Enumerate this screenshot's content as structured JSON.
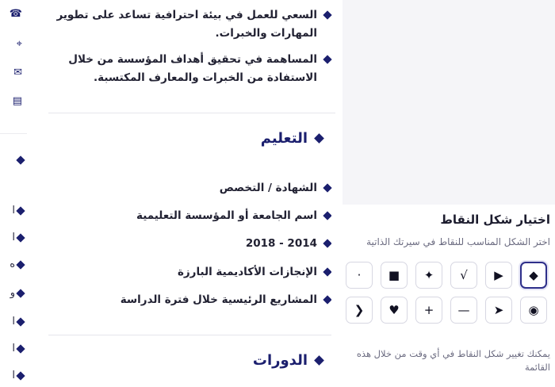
{
  "experience": {
    "bullets": [
      "السعي للعمل في بيئة احترافية تساعد على تطوير المهارات والخبرات.",
      "المساهمة في تحقيق أهداف المؤسسة من خلال الاستفادة من الخبرات والمعارف المكتسبة."
    ]
  },
  "education": {
    "title": "التعليم",
    "items": [
      "الشهادة / التخصص",
      "اسم الجامعة أو المؤسسة التعليمية",
      "2014 - 2018",
      "الإنجازات الأكاديمية البارزة",
      "المشاريع الرئيسية خلال فترة الدراسة"
    ]
  },
  "courses": {
    "title": "الدورات"
  },
  "left_strip": {
    "fragments": [
      "ا",
      "ا",
      "ه",
      "و",
      "ا",
      "ا",
      "ا"
    ]
  },
  "picker": {
    "title": "اختيار شكل النقاط",
    "subtitle": "اختر الشكل المناسب للنقاط في سيرتك الذاتية",
    "selected": "diamond",
    "options": [
      {
        "id": "diamond",
        "glyph": "◆",
        "name": "diamond-bullet-icon"
      },
      {
        "id": "triangle",
        "glyph": "▶",
        "name": "triangle-bullet-icon"
      },
      {
        "id": "check",
        "glyph": "√",
        "name": "check-bullet-icon"
      },
      {
        "id": "star",
        "glyph": "✦",
        "name": "star-bullet-icon"
      },
      {
        "id": "square",
        "glyph": "■",
        "name": "square-bullet-icon"
      },
      {
        "id": "dot",
        "glyph": "·",
        "name": "dot-bullet-icon"
      },
      {
        "id": "target",
        "glyph": "◉",
        "name": "target-bullet-icon"
      },
      {
        "id": "arrowhead",
        "glyph": "➤",
        "name": "arrowhead-bullet-icon"
      },
      {
        "id": "dash",
        "glyph": "—",
        "name": "dash-bullet-icon"
      },
      {
        "id": "plus",
        "glyph": "+",
        "name": "plus-bullet-icon"
      },
      {
        "id": "heart",
        "glyph": "♥",
        "name": "heart-bullet-icon"
      },
      {
        "id": "chevron",
        "glyph": "❮",
        "name": "chevron-bullet-icon"
      }
    ],
    "note": "يمكنك تغيير شكل النقاط في أي وقت من خلال هذه القائمة"
  },
  "colors": {
    "accent": "#1b1f6e",
    "selected_border": "#2e2f8a",
    "background_gray": "#f5f5f8"
  }
}
